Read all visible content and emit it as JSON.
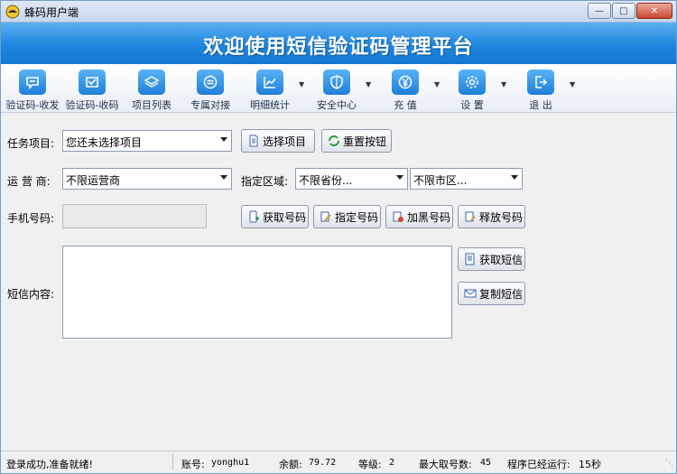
{
  "window": {
    "title": "蜂码用户端"
  },
  "banner": {
    "title": "欢迎使用短信验证码管理平台"
  },
  "toolbar": {
    "items": [
      {
        "label": "验证码-收发",
        "icon": "sms-send-icon"
      },
      {
        "label": "验证码-收码",
        "icon": "sms-receive-icon"
      },
      {
        "label": "项目列表",
        "icon": "layers-icon"
      },
      {
        "label": "专属对接",
        "icon": "link-icon"
      },
      {
        "label": "明细统计",
        "icon": "chart-icon"
      },
      {
        "label": "安全中心",
        "icon": "shield-icon"
      },
      {
        "label": "充 值",
        "icon": "yen-icon"
      },
      {
        "label": "设 置",
        "icon": "gear-icon"
      },
      {
        "label": "退 出",
        "icon": "exit-icon"
      }
    ]
  },
  "form": {
    "task_label": "任务项目:",
    "task_value": "您还未选择项目",
    "select_project_btn": "选择项目",
    "reset_btn": "重置按钮",
    "carrier_label": "运 营 商:",
    "carrier_value": "不限运营商",
    "region_label": "指定区域:",
    "province_value": "不限省份...",
    "city_value": "不限市区...",
    "phone_label": "手机号码:",
    "get_number_btn": "获取号码",
    "specify_number_btn": "指定号码",
    "blacklist_btn": "加黑号码",
    "release_btn": "释放号码",
    "sms_label": "短信内容:",
    "get_sms_btn": "获取短信",
    "copy_sms_btn": "复制短信"
  },
  "status": {
    "message": "登录成功,准备就绪!",
    "account_label": "账号:",
    "account_value": "yonghu1",
    "balance_label": "余额:",
    "balance_value": "79.72",
    "level_label": "等级:",
    "level_value": "2",
    "max_label": "最大取号数:",
    "max_value": "45",
    "runtime_label": "程序已经运行:",
    "runtime_value": "15秒"
  },
  "colors": {
    "banner": "#1e86de",
    "accent": "#2f8fe6"
  }
}
